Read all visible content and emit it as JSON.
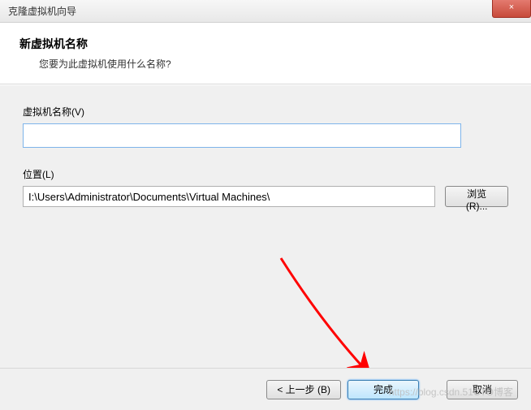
{
  "titlebar": {
    "title": "克隆虚拟机向导",
    "close": "×"
  },
  "header": {
    "title": "新虚拟机名称",
    "subtitle": "您要为此虚拟机使用什么名称?"
  },
  "form": {
    "name_label": "虚拟机名称(V)",
    "name_value": "",
    "location_label": "位置(L)",
    "location_value": "I:\\Users\\Administrator\\Documents\\Virtual Machines\\",
    "browse_label": "浏览(R)..."
  },
  "footer": {
    "back": "< 上一步 (B)",
    "finish": "完成",
    "cancel": "取消"
  },
  "watermark": "https://blog.csdn.51CTO博客"
}
